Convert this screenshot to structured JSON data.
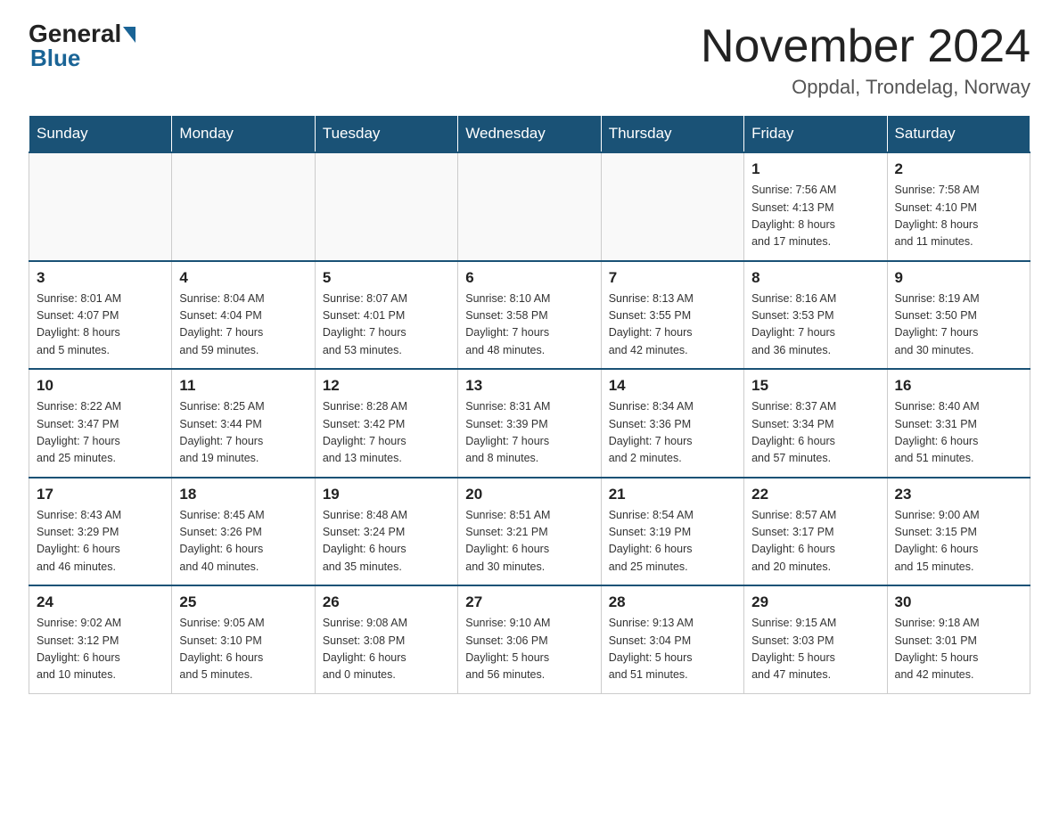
{
  "logo": {
    "general": "General",
    "blue": "Blue"
  },
  "title": "November 2024",
  "subtitle": "Oppdal, Trondelag, Norway",
  "weekdays": [
    "Sunday",
    "Monday",
    "Tuesday",
    "Wednesday",
    "Thursday",
    "Friday",
    "Saturday"
  ],
  "weeks": [
    [
      {
        "day": "",
        "info": ""
      },
      {
        "day": "",
        "info": ""
      },
      {
        "day": "",
        "info": ""
      },
      {
        "day": "",
        "info": ""
      },
      {
        "day": "",
        "info": ""
      },
      {
        "day": "1",
        "info": "Sunrise: 7:56 AM\nSunset: 4:13 PM\nDaylight: 8 hours\nand 17 minutes."
      },
      {
        "day": "2",
        "info": "Sunrise: 7:58 AM\nSunset: 4:10 PM\nDaylight: 8 hours\nand 11 minutes."
      }
    ],
    [
      {
        "day": "3",
        "info": "Sunrise: 8:01 AM\nSunset: 4:07 PM\nDaylight: 8 hours\nand 5 minutes."
      },
      {
        "day": "4",
        "info": "Sunrise: 8:04 AM\nSunset: 4:04 PM\nDaylight: 7 hours\nand 59 minutes."
      },
      {
        "day": "5",
        "info": "Sunrise: 8:07 AM\nSunset: 4:01 PM\nDaylight: 7 hours\nand 53 minutes."
      },
      {
        "day": "6",
        "info": "Sunrise: 8:10 AM\nSunset: 3:58 PM\nDaylight: 7 hours\nand 48 minutes."
      },
      {
        "day": "7",
        "info": "Sunrise: 8:13 AM\nSunset: 3:55 PM\nDaylight: 7 hours\nand 42 minutes."
      },
      {
        "day": "8",
        "info": "Sunrise: 8:16 AM\nSunset: 3:53 PM\nDaylight: 7 hours\nand 36 minutes."
      },
      {
        "day": "9",
        "info": "Sunrise: 8:19 AM\nSunset: 3:50 PM\nDaylight: 7 hours\nand 30 minutes."
      }
    ],
    [
      {
        "day": "10",
        "info": "Sunrise: 8:22 AM\nSunset: 3:47 PM\nDaylight: 7 hours\nand 25 minutes."
      },
      {
        "day": "11",
        "info": "Sunrise: 8:25 AM\nSunset: 3:44 PM\nDaylight: 7 hours\nand 19 minutes."
      },
      {
        "day": "12",
        "info": "Sunrise: 8:28 AM\nSunset: 3:42 PM\nDaylight: 7 hours\nand 13 minutes."
      },
      {
        "day": "13",
        "info": "Sunrise: 8:31 AM\nSunset: 3:39 PM\nDaylight: 7 hours\nand 8 minutes."
      },
      {
        "day": "14",
        "info": "Sunrise: 8:34 AM\nSunset: 3:36 PM\nDaylight: 7 hours\nand 2 minutes."
      },
      {
        "day": "15",
        "info": "Sunrise: 8:37 AM\nSunset: 3:34 PM\nDaylight: 6 hours\nand 57 minutes."
      },
      {
        "day": "16",
        "info": "Sunrise: 8:40 AM\nSunset: 3:31 PM\nDaylight: 6 hours\nand 51 minutes."
      }
    ],
    [
      {
        "day": "17",
        "info": "Sunrise: 8:43 AM\nSunset: 3:29 PM\nDaylight: 6 hours\nand 46 minutes."
      },
      {
        "day": "18",
        "info": "Sunrise: 8:45 AM\nSunset: 3:26 PM\nDaylight: 6 hours\nand 40 minutes."
      },
      {
        "day": "19",
        "info": "Sunrise: 8:48 AM\nSunset: 3:24 PM\nDaylight: 6 hours\nand 35 minutes."
      },
      {
        "day": "20",
        "info": "Sunrise: 8:51 AM\nSunset: 3:21 PM\nDaylight: 6 hours\nand 30 minutes."
      },
      {
        "day": "21",
        "info": "Sunrise: 8:54 AM\nSunset: 3:19 PM\nDaylight: 6 hours\nand 25 minutes."
      },
      {
        "day": "22",
        "info": "Sunrise: 8:57 AM\nSunset: 3:17 PM\nDaylight: 6 hours\nand 20 minutes."
      },
      {
        "day": "23",
        "info": "Sunrise: 9:00 AM\nSunset: 3:15 PM\nDaylight: 6 hours\nand 15 minutes."
      }
    ],
    [
      {
        "day": "24",
        "info": "Sunrise: 9:02 AM\nSunset: 3:12 PM\nDaylight: 6 hours\nand 10 minutes."
      },
      {
        "day": "25",
        "info": "Sunrise: 9:05 AM\nSunset: 3:10 PM\nDaylight: 6 hours\nand 5 minutes."
      },
      {
        "day": "26",
        "info": "Sunrise: 9:08 AM\nSunset: 3:08 PM\nDaylight: 6 hours\nand 0 minutes."
      },
      {
        "day": "27",
        "info": "Sunrise: 9:10 AM\nSunset: 3:06 PM\nDaylight: 5 hours\nand 56 minutes."
      },
      {
        "day": "28",
        "info": "Sunrise: 9:13 AM\nSunset: 3:04 PM\nDaylight: 5 hours\nand 51 minutes."
      },
      {
        "day": "29",
        "info": "Sunrise: 9:15 AM\nSunset: 3:03 PM\nDaylight: 5 hours\nand 47 minutes."
      },
      {
        "day": "30",
        "info": "Sunrise: 9:18 AM\nSunset: 3:01 PM\nDaylight: 5 hours\nand 42 minutes."
      }
    ]
  ]
}
